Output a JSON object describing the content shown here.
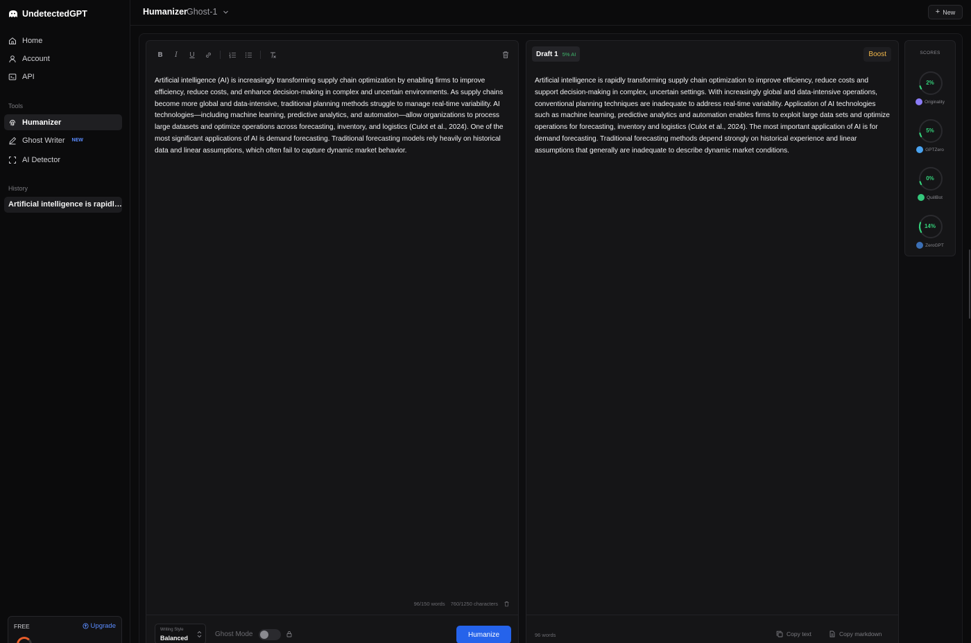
{
  "brand": {
    "name": "UndetectedGPT"
  },
  "sidebar": {
    "nav": [
      {
        "label": "Home",
        "icon": "home-icon"
      },
      {
        "label": "Account",
        "icon": "user-icon"
      },
      {
        "label": "API",
        "icon": "api-icon"
      }
    ],
    "tools_label": "Tools",
    "tools": [
      {
        "label": "Humanizer",
        "icon": "fingerprint-icon",
        "active": true
      },
      {
        "label": "Ghost Writer",
        "icon": "pen-icon",
        "badge": "NEW"
      },
      {
        "label": "AI Detector",
        "icon": "scan-icon"
      }
    ],
    "history_label": "History",
    "history": [
      {
        "label": "Artificial intelligence is rapidly tr..."
      }
    ],
    "plan": {
      "tier": "FREE",
      "upgrade_label": "Upgrade"
    }
  },
  "header": {
    "title": "Humanizer",
    "model": "Ghost-1",
    "new_label": "New"
  },
  "editor": {
    "text": "Artificial intelligence (AI) is increasingly transforming supply chain optimization by enabling firms to improve efficiency, reduce costs, and enhance decision-making in complex and uncertain environments. As supply chains become more global and data-intensive, traditional planning methods struggle to manage real-time variability. AI technologies—including machine learning, predictive analytics, and automation—allow organizations to process large datasets and optimize operations across forecasting, inventory, and logistics (Culot et al., 2024). One of the most significant applications of AI is demand forecasting. Traditional forecasting models rely heavily on historical data and linear assumptions, which often fail to capture dynamic market behavior.",
    "word_count": "96/150 words",
    "char_count": "760/1250 characters",
    "writing_style_label": "Writing Style",
    "writing_style_value": "Balanced",
    "ghost_mode_label": "Ghost Mode",
    "humanize_label": "Humanize"
  },
  "output": {
    "draft_name": "Draft 1",
    "draft_ai": "5% AI",
    "boost_label": "Boost",
    "text": "Artificial intelligence is rapidly transforming supply chain optimization to improve efficiency, reduce costs and support decision-making in complex, uncertain settings. With increasingly global and data-intensive operations, conventional planning techniques are inadequate to address real-time variability. Application of AI technologies such as machine learning, predictive analytics and automation enables firms to exploit large data sets and optimize operations for forecasting, inventory and logistics (Culot et al., 2024). The most important application of AI is for demand forecasting. Traditional forecasting methods depend strongly on historical experience and linear assumptions that generally are inadequate to describe dynamic market conditions.",
    "word_count": "96 words",
    "copy_text_label": "Copy text",
    "copy_markdown_label": "Copy markdown"
  },
  "scores": {
    "title": "SCORES",
    "items": [
      {
        "value": "2%",
        "fraction": 0.02,
        "detector": "Originality",
        "logo_color": "#8b7cf6"
      },
      {
        "value": "5%",
        "fraction": 0.05,
        "detector": "GPTZero",
        "logo_color": "#4aa3f0"
      },
      {
        "value": "0%",
        "fraction": 0.0,
        "detector": "QuillBot",
        "logo_color": "#34c77b"
      },
      {
        "value": "14%",
        "fraction": 0.14,
        "detector": "ZeroGPT",
        "logo_color": "#3b6fb5"
      }
    ]
  },
  "colors": {
    "accent": "#2563eb",
    "score_green": "#34d17a",
    "boost": "#f5b94a"
  }
}
